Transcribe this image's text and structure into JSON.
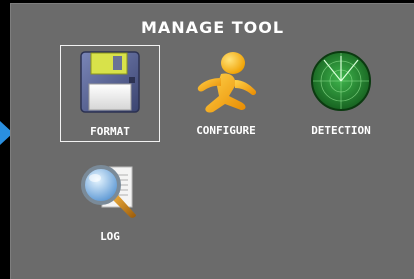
{
  "window": {
    "title": "MANAGE TOOL"
  },
  "tools": [
    {
      "id": "format",
      "label": "FORMAT",
      "icon": "floppy-disk-icon",
      "selected": true
    },
    {
      "id": "configure",
      "label": "CONFIGURE",
      "icon": "running-figure-icon",
      "selected": false
    },
    {
      "id": "detection",
      "label": "DETECTION",
      "icon": "radar-icon",
      "selected": false
    },
    {
      "id": "log",
      "label": "LOG",
      "icon": "magnifier-document-icon",
      "selected": false
    }
  ],
  "colors": {
    "panel_background": "#6b6b6b",
    "page_background": "#000000",
    "selection_border": "#f2f2f2",
    "pointer_arrow": "#2a8fe0",
    "text": "#ffffff"
  },
  "icons": {
    "pointer": "pointer-arrow-icon"
  }
}
